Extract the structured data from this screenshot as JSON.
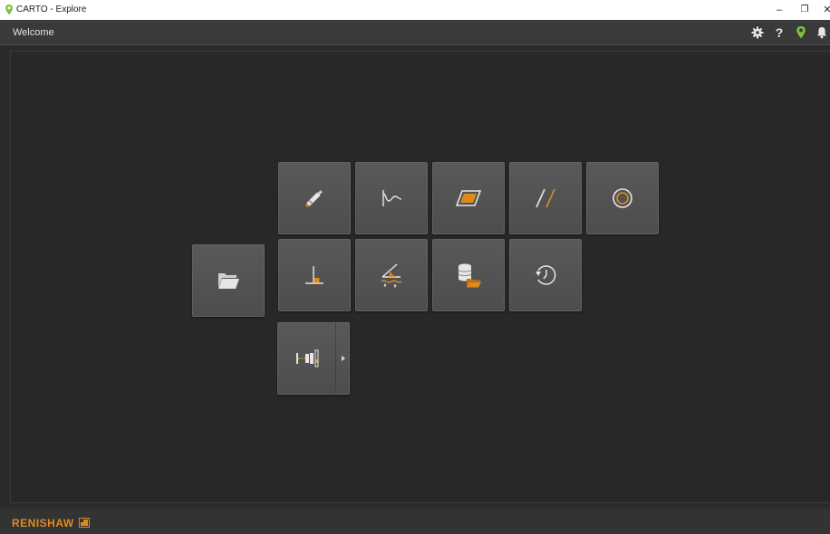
{
  "window": {
    "title": "CARTO - Explore",
    "controls": {
      "minimize": "–",
      "restore": "❐",
      "close": "✕"
    }
  },
  "header": {
    "title": "Welcome",
    "icons": [
      "settings-icon",
      "help-icon",
      "location-pin-icon",
      "notification-bell-icon"
    ],
    "help_glyph": "?"
  },
  "tiles": [
    {
      "name": "open-file-tile",
      "icon": "folder-open-icon"
    },
    {
      "name": "laser-measurement-tile",
      "icon": "laser-pen-icon"
    },
    {
      "name": "dynamic-measurement-tile",
      "icon": "waveform-icon"
    },
    {
      "name": "flatness-tile",
      "icon": "parallelogram-icon"
    },
    {
      "name": "parallelism-tile",
      "icon": "parallel-lines-icon"
    },
    {
      "name": "rotary-tile",
      "icon": "circle-target-icon"
    },
    {
      "name": "squareness-tile",
      "icon": "perpendicular-icon"
    },
    {
      "name": "angular-tile",
      "icon": "angle-wave-icon"
    },
    {
      "name": "database-tile",
      "icon": "database-folder-icon"
    },
    {
      "name": "history-tile",
      "icon": "history-clock-icon"
    },
    {
      "name": "xm-system-tile",
      "icon": "xm-system-icon",
      "has_dropdown": true
    }
  ],
  "footer": {
    "brand": "RENISHAW"
  },
  "colors": {
    "accent": "#e08a1e",
    "pin_green": "#7cc242",
    "tile": "#555555",
    "background": "#282828"
  }
}
